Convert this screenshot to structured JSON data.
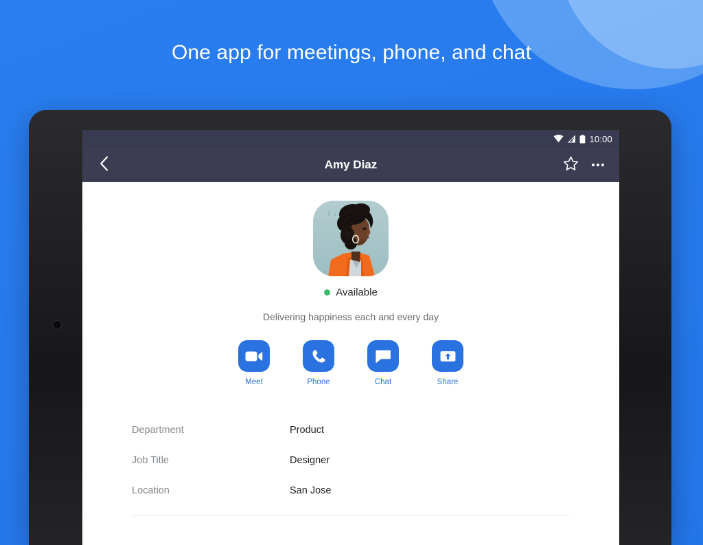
{
  "promo": {
    "headline": "One app for meetings, phone, and chat",
    "background_color": "#2a7ef0",
    "arc_color": "#8dbffb"
  },
  "device": {
    "type": "tablet",
    "frame_color": "#1d1d1f"
  },
  "status_bar": {
    "time": "10:00",
    "icons": [
      "wifi-icon",
      "cellular-signal-icon",
      "battery-icon"
    ],
    "background_color": "#393b50"
  },
  "app_bar": {
    "title": "Amy Diaz",
    "back_icon": "back-chevron-icon",
    "star_icon": "star-outline-icon",
    "overflow_icon": "overflow-menu-icon",
    "background_color": "#3c3d52"
  },
  "profile": {
    "avatar_alt": "Amy Diaz profile photo",
    "presence": {
      "label": "Available",
      "color": "#3bbb6b"
    },
    "tagline": "Delivering happiness each and every day",
    "actions": [
      {
        "label": "Meet",
        "icon": "video-camera-icon"
      },
      {
        "label": "Phone",
        "icon": "phone-handset-icon"
      },
      {
        "label": "Chat",
        "icon": "chat-bubble-icon"
      },
      {
        "label": "Share",
        "icon": "share-upload-icon"
      }
    ],
    "accent_color": "#2a72e0",
    "details": [
      {
        "key": "Department",
        "value": "Product"
      },
      {
        "key": "Job Title",
        "value": "Designer"
      },
      {
        "key": "Location",
        "value": "San Jose"
      }
    ]
  }
}
